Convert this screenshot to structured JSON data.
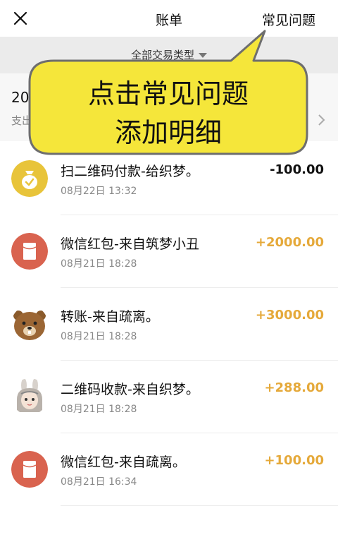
{
  "header": {
    "title": "账单",
    "faq_label": "常见问题",
    "close_icon": "close-icon"
  },
  "filter": {
    "label": "全部交易类型"
  },
  "summary": {
    "month": "20",
    "stats": "支出"
  },
  "callout": {
    "line1": "点击常见问题",
    "line2": "添加明细",
    "color": "#f5e63a"
  },
  "colors": {
    "positive": "#e5a93a",
    "negative": "#111111",
    "red_packet": "#d9634f",
    "pay_yellow": "#e8c43a"
  },
  "transactions": [
    {
      "name": "扫二维码付款-给织梦。",
      "time": "08月22日 13:32",
      "amount": "-100.00",
      "sign": "neg",
      "icon": "money-bag-icon"
    },
    {
      "name": "微信红包-来自筑梦小丑",
      "time": "08月21日 18:28",
      "amount": "+2000.00",
      "sign": "pos",
      "icon": "red-packet-icon"
    },
    {
      "name": "转账-来自疏离。",
      "time": "08月21日 18:28",
      "amount": "+3000.00",
      "sign": "pos",
      "icon": "bear-avatar"
    },
    {
      "name": "二维码收款-来自织梦。",
      "time": "08月21日 18:28",
      "amount": "+288.00",
      "sign": "pos",
      "icon": "girl-avatar"
    },
    {
      "name": "微信红包-来自疏离。",
      "time": "08月21日 16:34",
      "amount": "+100.00",
      "sign": "pos",
      "icon": "red-packet-icon"
    }
  ]
}
